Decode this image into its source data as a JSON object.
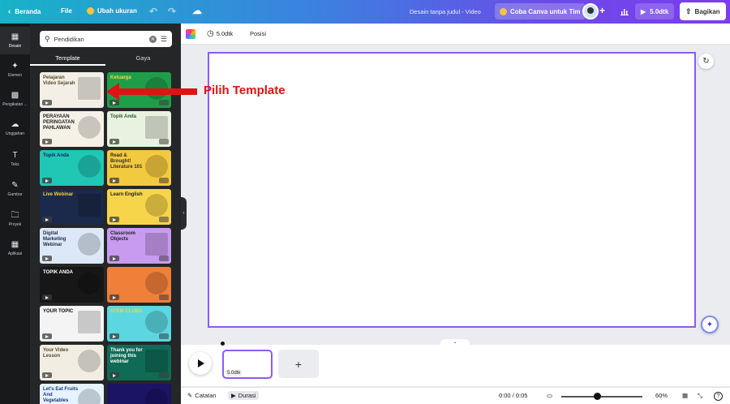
{
  "topbar": {
    "back_label": "Beranda",
    "file_label": "File",
    "resize_label": "Ubah ukuran",
    "doc_title": "Desain tanpa judul - Video",
    "try_pro_label": "Coba Canva untuk Tim",
    "play_label": "5.0dtk",
    "share_label": "Bagikan",
    "gradient_colors": [
      "#17b3c8",
      "#3d7fe0",
      "#6a4be8",
      "#7d3cf0"
    ]
  },
  "rail": {
    "items": [
      {
        "label": "Desain",
        "icon": "design-icon"
      },
      {
        "label": "Elemen",
        "icon": "elements-icon"
      },
      {
        "label": "Pengikatan ...",
        "icon": "brand-icon"
      },
      {
        "label": "Unggahan",
        "icon": "upload-icon"
      },
      {
        "label": "Teks",
        "icon": "text-icon"
      },
      {
        "label": "Gambar",
        "icon": "draw-icon"
      },
      {
        "label": "Proyek",
        "icon": "folder-icon"
      },
      {
        "label": "Aplikasi",
        "icon": "apps-icon"
      }
    ]
  },
  "panel": {
    "search_value": "Pendidikan",
    "tabs": [
      "Template",
      "Gaya"
    ],
    "thumbs": [
      {
        "text": "Pelajaran Video Sejarah",
        "bg": "#f3efe6",
        "fg": "#5a4a2a"
      },
      {
        "text": "Keluarga",
        "bg": "#1f9e4a",
        "fg": "#ffd54a"
      },
      {
        "text": "PERAYAAN PERINGATAN PAHLAWAN",
        "bg": "#f6f1e7",
        "fg": "#222"
      },
      {
        "text": "Topik Anda",
        "bg": "#e9f2e0",
        "fg": "#2e5d2e"
      },
      {
        "text": "Topik Anda",
        "bg": "#20c7b5",
        "fg": "#102a5c"
      },
      {
        "text": "Read & Brought! Literature 101",
        "bg": "#f3c93f",
        "fg": "#2c2c2c"
      },
      {
        "text": "Live Webinar",
        "bg": "#1b2a4a",
        "fg": "#f6d33c"
      },
      {
        "text": "Learn English",
        "bg": "#f7d54a",
        "fg": "#222"
      },
      {
        "text": "Digital Marketing Webinar",
        "bg": "#dce8f7",
        "fg": "#1b2a4a"
      },
      {
        "text": "Classroom Objects",
        "bg": "#c99bf0",
        "fg": "#222"
      },
      {
        "text": "TOPIK ANDA",
        "bg": "#171717",
        "fg": "#fff"
      },
      {
        "text": "",
        "bg": "#f07f3a",
        "fg": "#fff"
      },
      {
        "text": "YOUR TOPIC",
        "bg": "#f4f4f4",
        "fg": "#111"
      },
      {
        "text": "STEM CLUBS",
        "bg": "#5cd6e0",
        "fg": "#f6d33c"
      },
      {
        "text": "Your Video Lesson",
        "bg": "#f1ede3",
        "fg": "#5a4a2a"
      },
      {
        "text": "Thank you for joining this webinar",
        "bg": "#0f6b55",
        "fg": "#fff"
      },
      {
        "text": "Let's Eat Fruits And Vegetables",
        "bg": "#e6f2ff",
        "fg": "#1b3a7a"
      },
      {
        "text": "",
        "bg": "#1b1464",
        "fg": "#fff"
      }
    ]
  },
  "annotation": {
    "label": "Pilih Template",
    "color": "#e11212"
  },
  "canvas_toolbar": {
    "duration_label": "5.0dtk",
    "position_label": "Posisi"
  },
  "timeline": {
    "clip_label": "5.0dtk",
    "add_label": "+"
  },
  "bottombar": {
    "notes_label": "Catatan",
    "duration_label": "Durasi",
    "time": "0:00 / 0:05",
    "zoom": "60%",
    "zoom_fraction": 0.44,
    "help_label": "?"
  },
  "accent_color": "#8b5cf6"
}
